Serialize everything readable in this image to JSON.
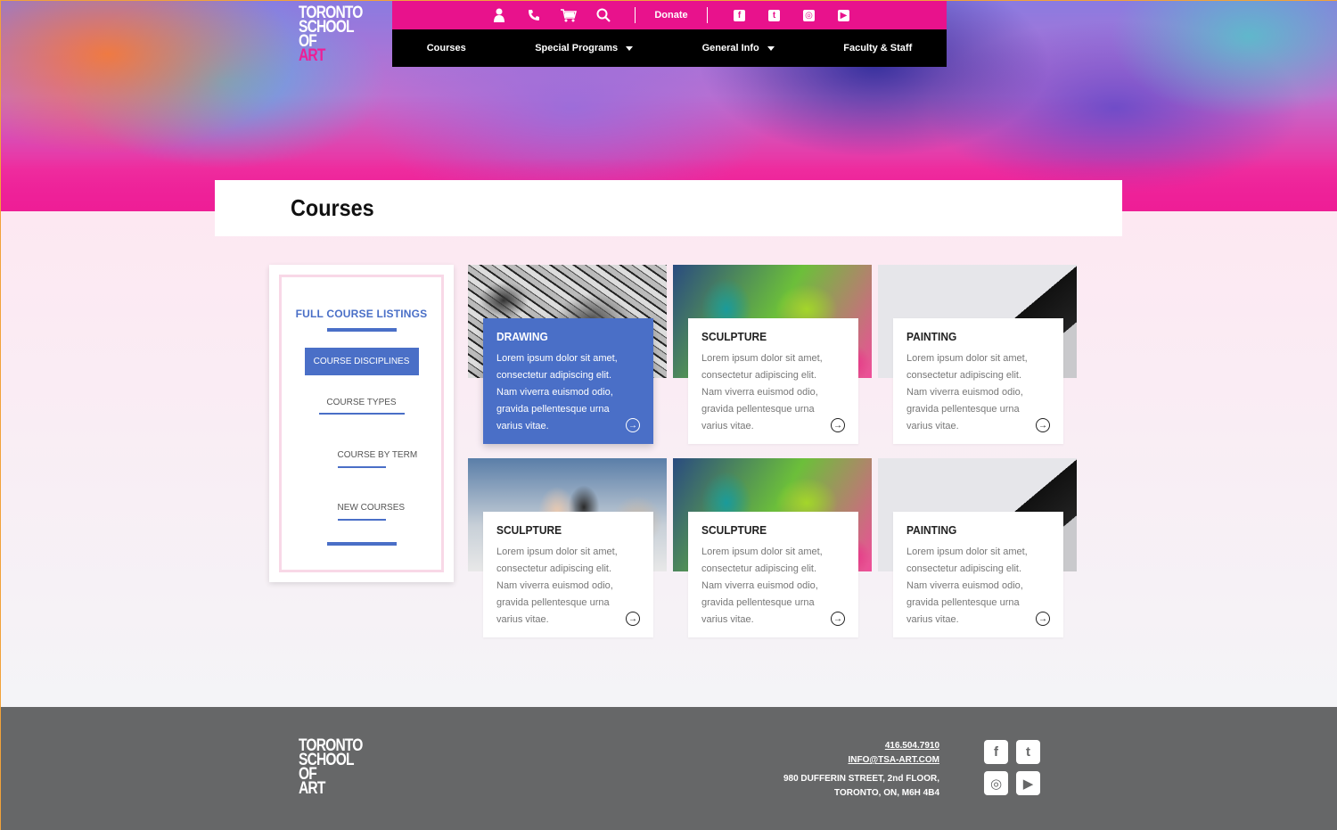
{
  "brand": {
    "logo_lines": [
      "TORONTO",
      "SCHOOL",
      "OF",
      "ART"
    ]
  },
  "nav": {
    "utility": {
      "donate_label": "Donate",
      "icons": [
        "user-icon",
        "phone-icon",
        "cart-icon",
        "search-icon"
      ],
      "social_icons": [
        "facebook-icon",
        "twitter-icon",
        "instagram-icon",
        "youtube-icon"
      ]
    },
    "main": [
      {
        "label": "Courses",
        "has_dropdown": false
      },
      {
        "label": "Special Programs",
        "has_dropdown": true
      },
      {
        "label": "General Info",
        "has_dropdown": true
      },
      {
        "label": "Faculty & Staff",
        "has_dropdown": false
      }
    ]
  },
  "page": {
    "title": "Courses"
  },
  "sidebar": {
    "heading": "FULL COURSE LISTINGS",
    "active_item": "COURSE DISCIPLINES",
    "links": [
      "COURSE TYPES",
      "COURSE BY TERM",
      "NEW COURSES"
    ]
  },
  "cards": [
    {
      "title": "DRAWING",
      "desc": "Lorem ipsum dolor sit amet, consectetur adipiscing elit. Nam viverra euismod odio, gravida pellentesque urna varius vitae.",
      "active": true
    },
    {
      "title": "SCULPTURE",
      "desc": "Lorem ipsum dolor sit amet, consectetur adipiscing elit. Nam viverra euismod odio, gravida pellentesque urna varius vitae.",
      "active": false
    },
    {
      "title": "PAINTING",
      "desc": "Lorem ipsum dolor sit amet, consectetur adipiscing elit. Nam viverra euismod odio, gravida pellentesque urna varius vitae.",
      "active": false
    },
    {
      "title": "SCULPTURE",
      "desc": "Lorem ipsum dolor sit amet, consectetur adipiscing elit. Nam viverra euismod odio, gravida pellentesque urna varius vitae.",
      "active": false
    },
    {
      "title": "SCULPTURE",
      "desc": "Lorem ipsum dolor sit amet, consectetur adipiscing elit. Nam viverra euismod odio, gravida pellentesque urna varius vitae.",
      "active": false
    },
    {
      "title": "PAINTING",
      "desc": "Lorem ipsum dolor sit amet, consectetur adipiscing elit. Nam viverra euismod odio, gravida pellentesque urna varius vitae.",
      "active": false
    }
  ],
  "footer": {
    "phone": "416.504.7910",
    "email": "INFO@TSA-ART.COM",
    "address_line1": "980 DUFFERIN STREET, 2nd FLOOR,",
    "address_line2": "TORONTO, ON, M6H 4B4",
    "social_icons": [
      "facebook-icon",
      "twitter-icon",
      "instagram-icon",
      "youtube-icon"
    ]
  },
  "colors": {
    "brand_pink": "#e8128c",
    "accent_blue": "#4a6fc7",
    "footer_gray": "#666768"
  }
}
